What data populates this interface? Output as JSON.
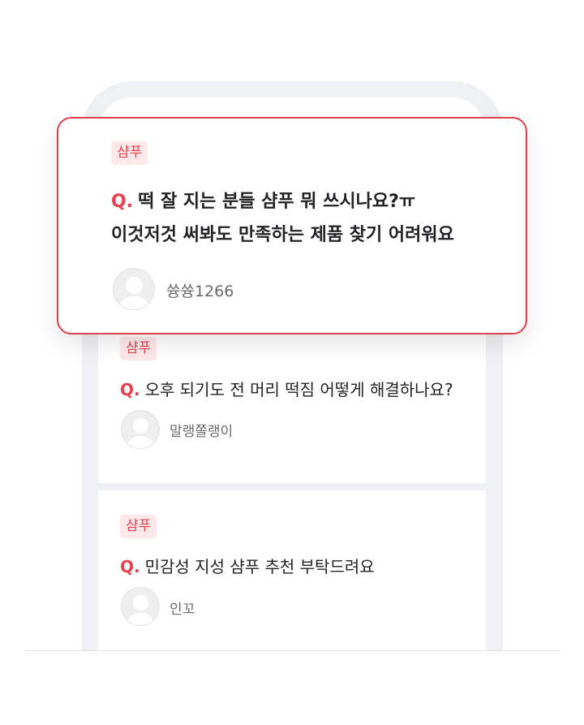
{
  "featured": {
    "tag": "샴푸",
    "q_prefix": "Q.",
    "title_line1": "떡 잘 지는 분들 샴푸 뭐 쓰시나요?ㅠ",
    "title_line2": "이것저것 써봐도 만족하는 제품 찾기 어려워요",
    "author": "쓩쓩1266"
  },
  "posts": [
    {
      "tag": "샴푸",
      "q_prefix": "Q.",
      "title": "오후 되기도 전 머리 떡짐 어떻게 해결하나요?",
      "author": "말랭쫄랭이"
    },
    {
      "tag": "샴푸",
      "q_prefix": "Q.",
      "title": "민감성 지성 샴푸 추천 부탁드려요",
      "author": "인꼬"
    }
  ],
  "colors": {
    "accent": "#e8404a",
    "tag_bg": "#fde9ea",
    "frame": "#eff0f3",
    "text": "#222226",
    "muted": "#6b6b6f"
  },
  "icons": {
    "avatar": "user-avatar-icon"
  }
}
